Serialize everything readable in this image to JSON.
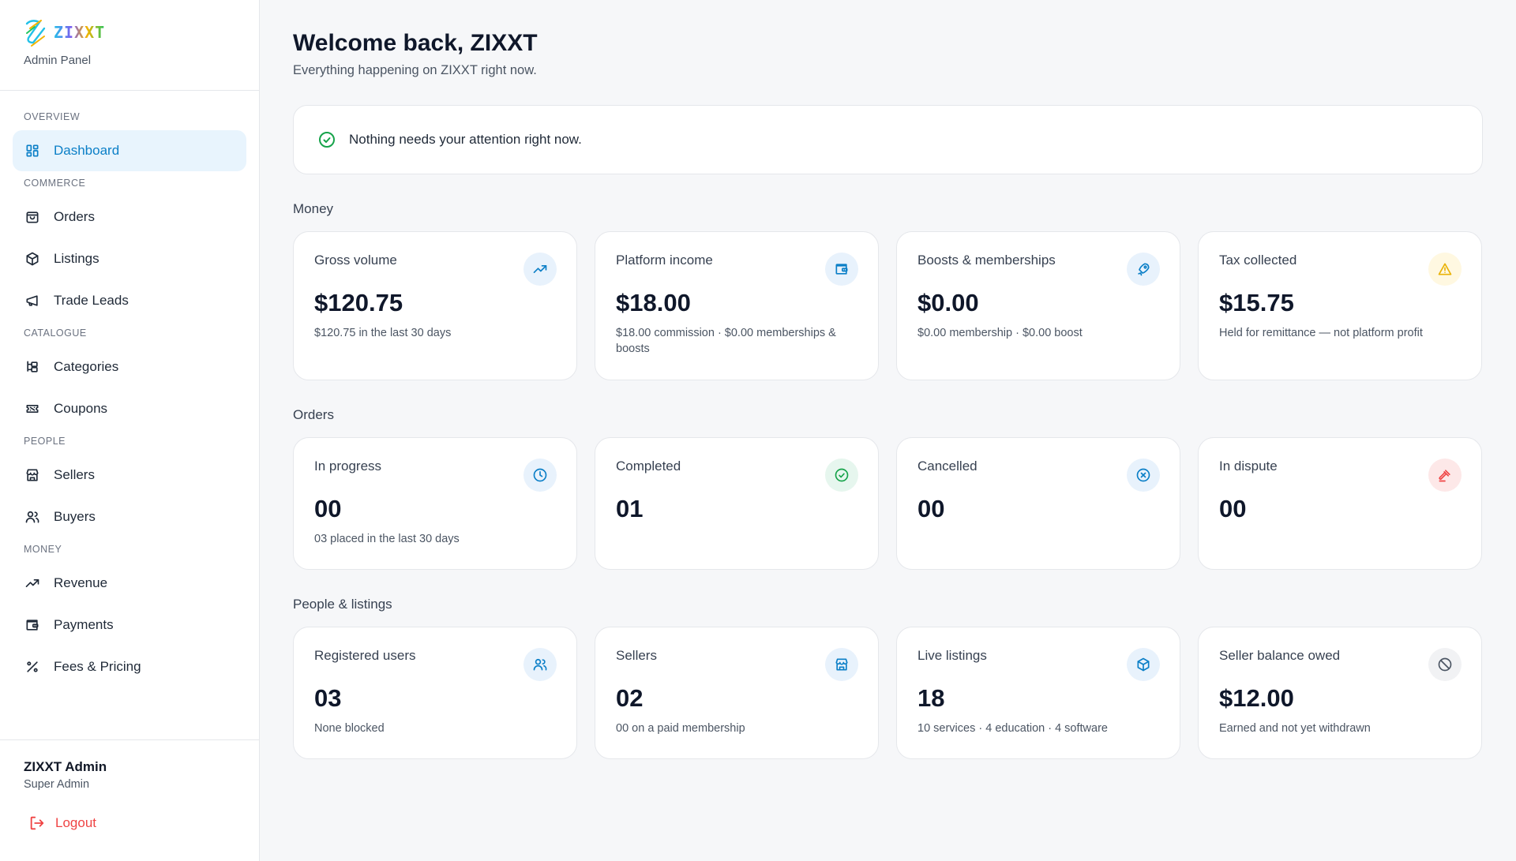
{
  "brand": {
    "word": "ZIXXT",
    "subtitle": "Admin Panel"
  },
  "nav": [
    {
      "section": "OVERVIEW",
      "items": [
        {
          "label": "Dashboard",
          "icon": "dashboard-icon",
          "active": true
        }
      ]
    },
    {
      "section": "COMMERCE",
      "items": [
        {
          "label": "Orders",
          "icon": "bag-icon"
        },
        {
          "label": "Listings",
          "icon": "box-icon"
        },
        {
          "label": "Trade Leads",
          "icon": "megaphone-icon"
        }
      ]
    },
    {
      "section": "CATALOGUE",
      "items": [
        {
          "label": "Categories",
          "icon": "tree-icon"
        },
        {
          "label": "Coupons",
          "icon": "ticket-icon"
        }
      ]
    },
    {
      "section": "PEOPLE",
      "items": [
        {
          "label": "Sellers",
          "icon": "store-icon"
        },
        {
          "label": "Buyers",
          "icon": "users-icon"
        }
      ]
    },
    {
      "section": "MONEY",
      "items": [
        {
          "label": "Revenue",
          "icon": "trending-up-icon"
        },
        {
          "label": "Payments",
          "icon": "wallet-icon"
        },
        {
          "label": "Fees & Pricing",
          "icon": "percent-icon"
        }
      ]
    }
  ],
  "user": {
    "name": "ZIXXT Admin",
    "role": "Super Admin",
    "logout": "Logout"
  },
  "header": {
    "title": "Welcome back, ZIXXT",
    "subtitle": "Everything happening on ZIXXT right now."
  },
  "notice": "Nothing needs your attention right now.",
  "groups": {
    "money": {
      "label": "Money",
      "cards": [
        {
          "title": "Gross volume",
          "value": "$120.75",
          "note": "$120.75 in the last 30 days",
          "icon": "trending-up-icon",
          "tone": "blue"
        },
        {
          "title": "Platform income",
          "value": "$18.00",
          "note": "$18.00 commission · $0.00 memberships & boosts",
          "icon": "wallet-icon",
          "tone": "blue"
        },
        {
          "title": "Boosts & memberships",
          "value": "$0.00",
          "note": "$0.00 membership · $0.00 boost",
          "icon": "rocket-icon",
          "tone": "blue"
        },
        {
          "title": "Tax collected",
          "value": "$15.75",
          "note": "Held for remittance — not platform profit",
          "icon": "warning-icon",
          "tone": "yellow"
        }
      ]
    },
    "orders": {
      "label": "Orders",
      "cards": [
        {
          "title": "In progress",
          "value": "00",
          "note": "03 placed in the last 30 days",
          "icon": "clock-icon",
          "tone": "blue"
        },
        {
          "title": "Completed",
          "value": "01",
          "note": "",
          "icon": "check-circle-icon",
          "tone": "green"
        },
        {
          "title": "Cancelled",
          "value": "00",
          "note": "",
          "icon": "x-circle-icon",
          "tone": "blue"
        },
        {
          "title": "In dispute",
          "value": "00",
          "note": "",
          "icon": "gavel-icon",
          "tone": "red"
        }
      ]
    },
    "people": {
      "label": "People & listings",
      "cards": [
        {
          "title": "Registered users",
          "value": "03",
          "note": "None blocked",
          "icon": "users-icon",
          "tone": "blue"
        },
        {
          "title": "Sellers",
          "value": "02",
          "note": "00 on a paid membership",
          "icon": "store-icon",
          "tone": "blue"
        },
        {
          "title": "Live listings",
          "value": "18",
          "note": "10 services · 4 education · 4 software",
          "icon": "box-icon",
          "tone": "blue"
        },
        {
          "title": "Seller balance owed",
          "value": "$12.00",
          "note": "Earned and not yet withdrawn",
          "icon": "ban-icon",
          "tone": "gray"
        }
      ]
    }
  }
}
